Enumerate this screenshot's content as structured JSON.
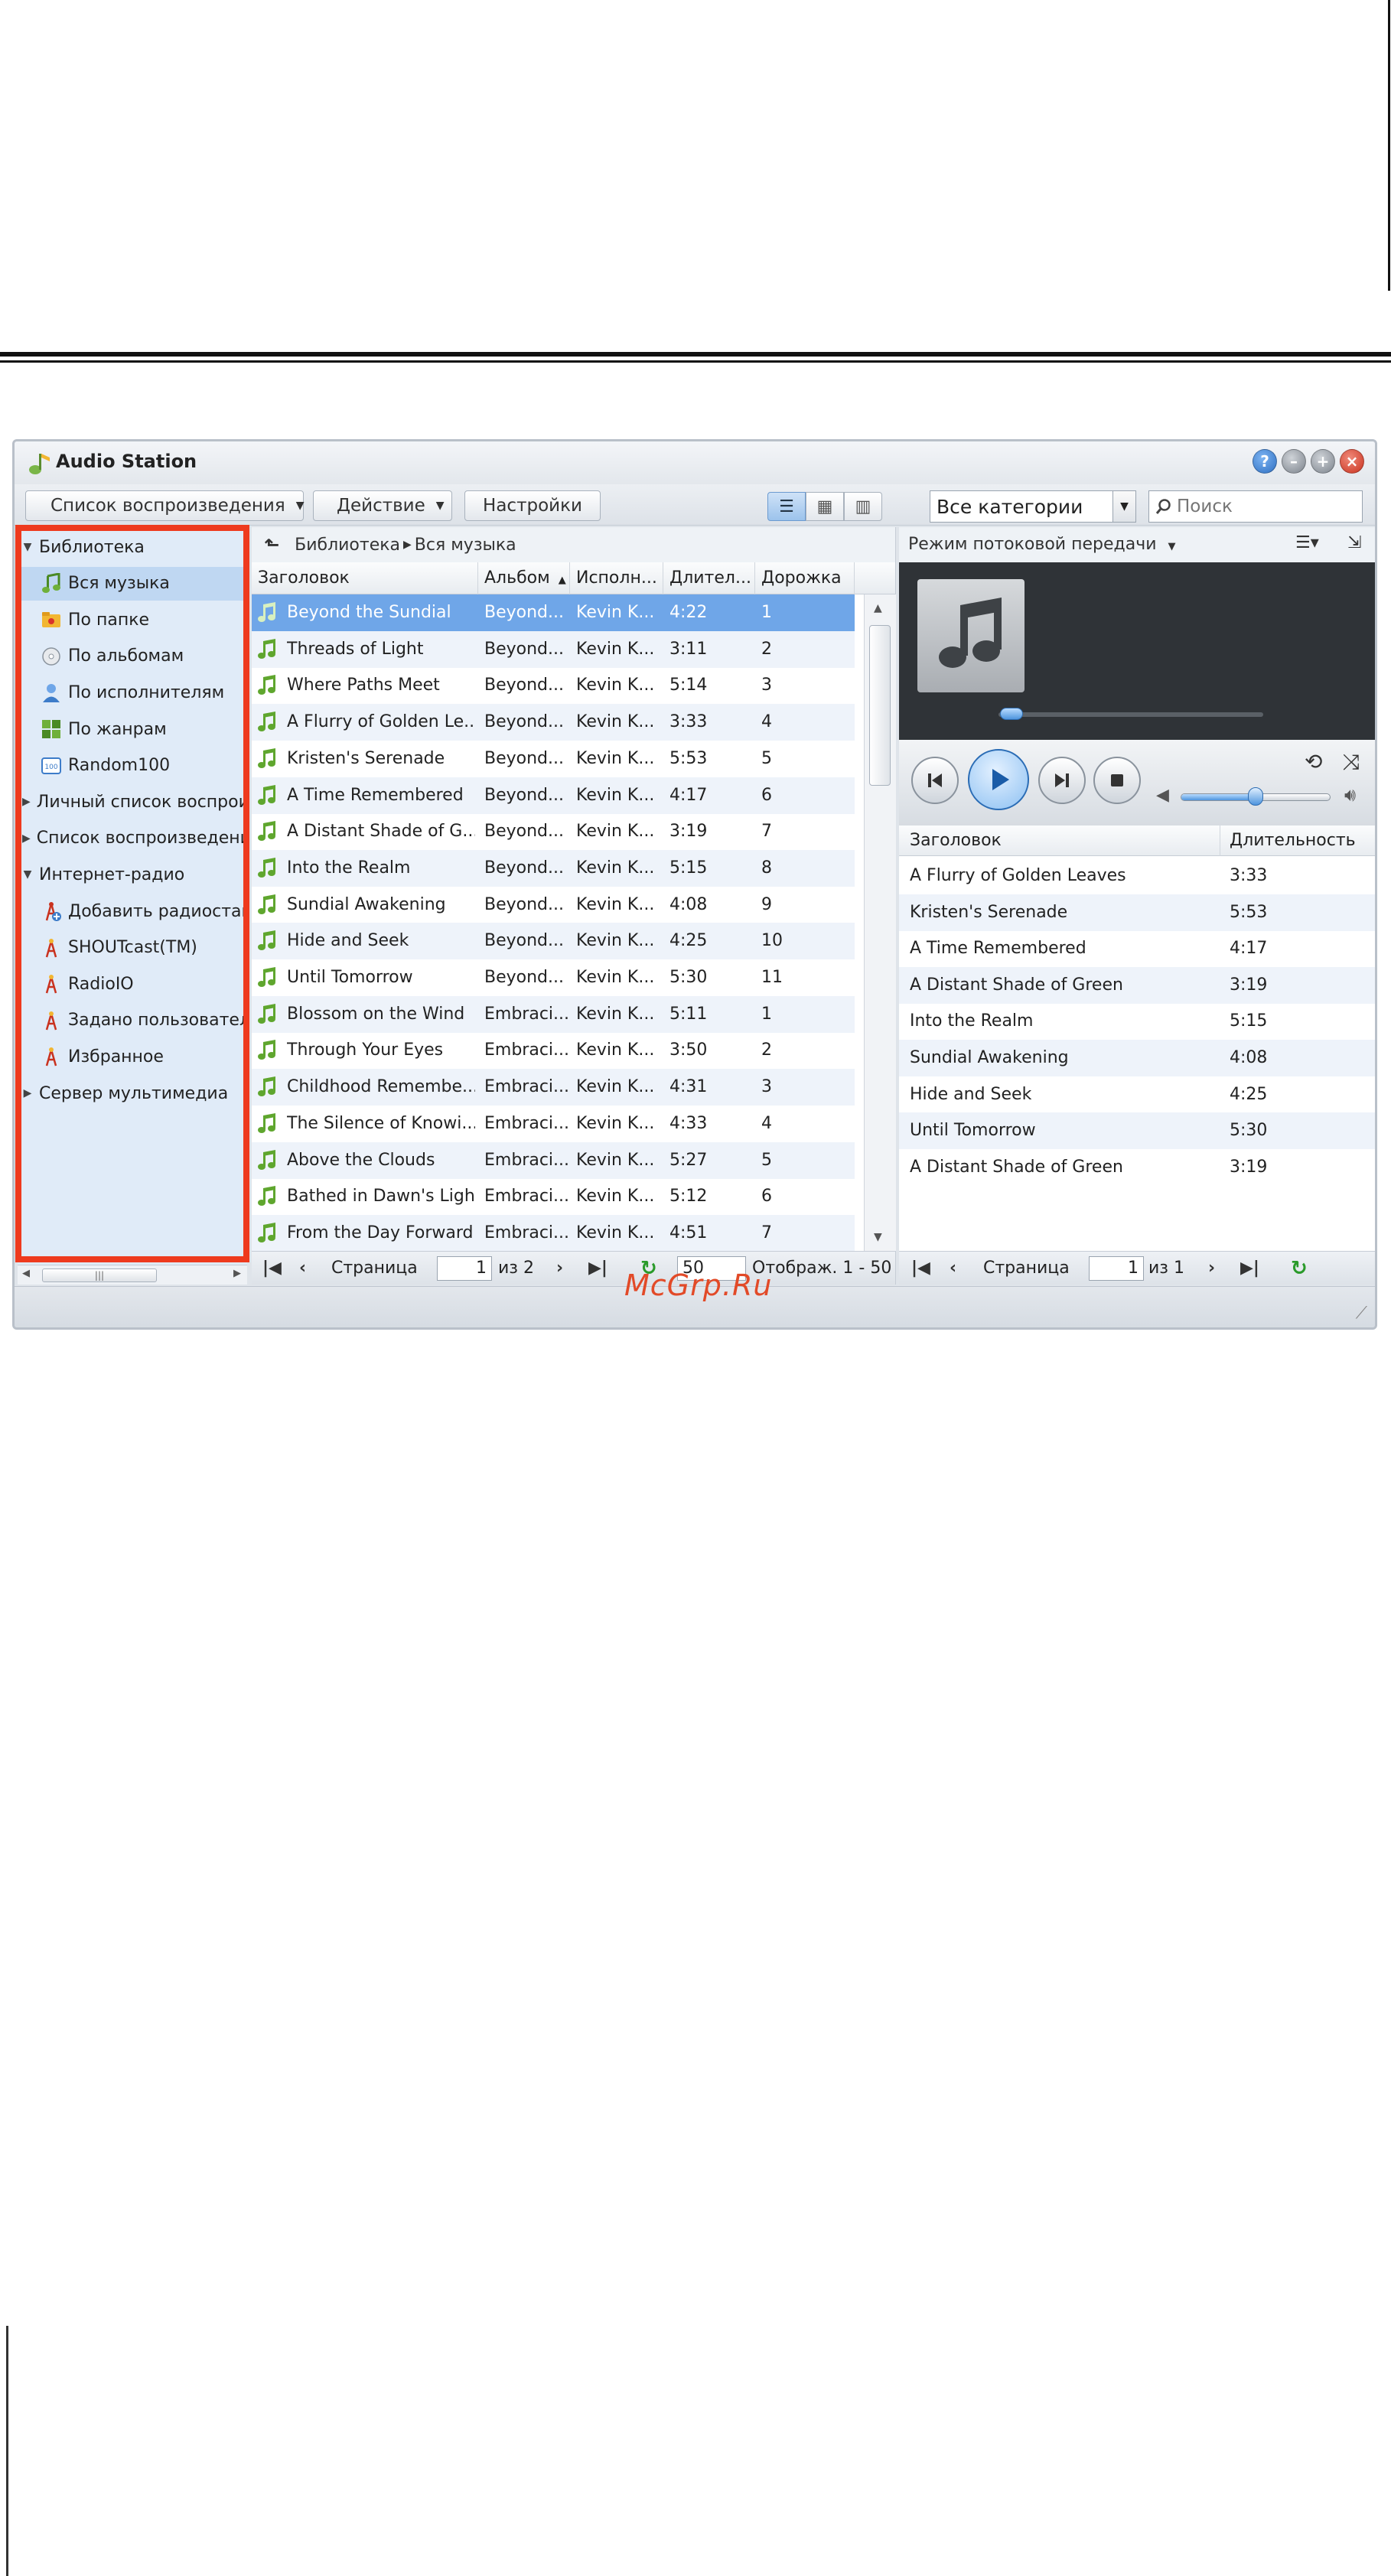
{
  "colors": {
    "highlight": "#ee3a1e",
    "selection": "#6fa6e8",
    "sidebar_bg": "#e0ebf8",
    "accent_green": "#2a9a2a"
  },
  "window": {
    "title": "Audio Station"
  },
  "toolbar": {
    "playlist_button": "Список воспроизведения",
    "action_button": "Действие",
    "settings_button": "Настройки",
    "category_select": "Все категории",
    "search_placeholder": "Поиск"
  },
  "sidebar": {
    "items": [
      {
        "label": "Библиотека",
        "level": 0,
        "expanded": true,
        "icon": ""
      },
      {
        "label": "Вся музыка",
        "level": 1,
        "selected": true,
        "icon": "music-note-icon"
      },
      {
        "label": "По папке",
        "level": 1,
        "icon": "folder-icon"
      },
      {
        "label": "По альбомам",
        "level": 1,
        "icon": "cd-icon"
      },
      {
        "label": "По исполнителям",
        "level": 1,
        "icon": "person-icon"
      },
      {
        "label": "По жанрам",
        "level": 1,
        "icon": "genre-grid-icon"
      },
      {
        "label": "Random100",
        "level": 1,
        "icon": "random100-icon"
      },
      {
        "label": "Личный список воспроизведения",
        "level": 0,
        "expanded": false,
        "icon": ""
      },
      {
        "label": "Список воспроизведения",
        "level": 0,
        "expanded": false,
        "icon": ""
      },
      {
        "label": "Интернет-радио",
        "level": 0,
        "expanded": true,
        "icon": ""
      },
      {
        "label": "Добавить радиостанцию",
        "level": 1,
        "icon": "add-radio-icon"
      },
      {
        "label": "SHOUTcast(TM)",
        "level": 1,
        "icon": "radio-tower-icon"
      },
      {
        "label": "RadioIO",
        "level": 1,
        "icon": "radio-tower-icon"
      },
      {
        "label": "Задано пользователем",
        "level": 1,
        "icon": "radio-tower-icon"
      },
      {
        "label": "Избранное",
        "level": 1,
        "icon": "radio-tower-icon"
      },
      {
        "label": "Сервер мультимедиа",
        "level": 0,
        "expanded": false,
        "icon": ""
      }
    ]
  },
  "library": {
    "breadcrumb": [
      "Библиотека",
      "Вся музыка"
    ],
    "columns": [
      "Заголовок",
      "Альбом",
      "Исполн...",
      "Длител...",
      "Дорожка"
    ],
    "rows": [
      {
        "title": "Beyond the Sundial",
        "album": "Beyond...",
        "artist": "Kevin K...",
        "duration": "4:22",
        "track": "1"
      },
      {
        "title": "Threads of Light",
        "album": "Beyond...",
        "artist": "Kevin K...",
        "duration": "3:11",
        "track": "2"
      },
      {
        "title": "Where Paths Meet",
        "album": "Beyond...",
        "artist": "Kevin K...",
        "duration": "5:14",
        "track": "3"
      },
      {
        "title": "A Flurry of Golden Le...",
        "album": "Beyond...",
        "artist": "Kevin K...",
        "duration": "3:33",
        "track": "4"
      },
      {
        "title": "Kristen's Serenade",
        "album": "Beyond...",
        "artist": "Kevin K...",
        "duration": "5:53",
        "track": "5"
      },
      {
        "title": "A Time Remembered",
        "album": "Beyond...",
        "artist": "Kevin K...",
        "duration": "4:17",
        "track": "6"
      },
      {
        "title": "A Distant Shade of G...",
        "album": "Beyond...",
        "artist": "Kevin K...",
        "duration": "3:19",
        "track": "7"
      },
      {
        "title": "Into the Realm",
        "album": "Beyond...",
        "artist": "Kevin K...",
        "duration": "5:15",
        "track": "8"
      },
      {
        "title": "Sundial Awakening",
        "album": "Beyond...",
        "artist": "Kevin K...",
        "duration": "4:08",
        "track": "9"
      },
      {
        "title": "Hide and Seek",
        "album": "Beyond...",
        "artist": "Kevin K...",
        "duration": "4:25",
        "track": "10"
      },
      {
        "title": "Until Tomorrow",
        "album": "Beyond...",
        "artist": "Kevin K...",
        "duration": "5:30",
        "track": "11"
      },
      {
        "title": "Blossom on the Wind",
        "album": "Embraci...",
        "artist": "Kevin K...",
        "duration": "5:11",
        "track": "1"
      },
      {
        "title": "Through Your Eyes",
        "album": "Embraci...",
        "artist": "Kevin K...",
        "duration": "3:50",
        "track": "2"
      },
      {
        "title": "Childhood Remembe...",
        "album": "Embraci...",
        "artist": "Kevin K...",
        "duration": "4:31",
        "track": "3"
      },
      {
        "title": "The Silence of Knowi...",
        "album": "Embraci...",
        "artist": "Kevin K...",
        "duration": "4:33",
        "track": "4"
      },
      {
        "title": "Above the Clouds",
        "album": "Embraci...",
        "artist": "Kevin K...",
        "duration": "5:27",
        "track": "5"
      },
      {
        "title": "Bathed in Dawn's Light",
        "album": "Embraci...",
        "artist": "Kevin K...",
        "duration": "5:12",
        "track": "6"
      },
      {
        "title": "From the Day Forward",
        "album": "Embraci...",
        "artist": "Kevin K...",
        "duration": "4:51",
        "track": "7"
      }
    ],
    "pager": {
      "page_label": "Страница",
      "page": "1",
      "of_label": "из 2",
      "page_size": "50",
      "display": "Отображ. 1 - 50"
    }
  },
  "player": {
    "mode_label": "Режим потоковой передачи",
    "progress": 0.0,
    "volume": 0.5,
    "queue_columns": [
      "Заголовок",
      "Длительность"
    ],
    "queue": [
      {
        "title": "A Flurry of Golden Leaves",
        "duration": "3:33"
      },
      {
        "title": "Kristen's Serenade",
        "duration": "5:53"
      },
      {
        "title": "A Time Remembered",
        "duration": "4:17"
      },
      {
        "title": "A Distant Shade of Green",
        "duration": "3:19"
      },
      {
        "title": "Into the Realm",
        "duration": "5:15"
      },
      {
        "title": "Sundial Awakening",
        "duration": "4:08"
      },
      {
        "title": "Hide and Seek",
        "duration": "4:25"
      },
      {
        "title": "Until Tomorrow",
        "duration": "5:30"
      },
      {
        "title": "A Distant Shade of Green",
        "duration": "3:19"
      }
    ],
    "pager": {
      "page_label": "Страница",
      "page": "1",
      "of_label": "из 1"
    }
  },
  "watermark": "McGrp.Ru"
}
